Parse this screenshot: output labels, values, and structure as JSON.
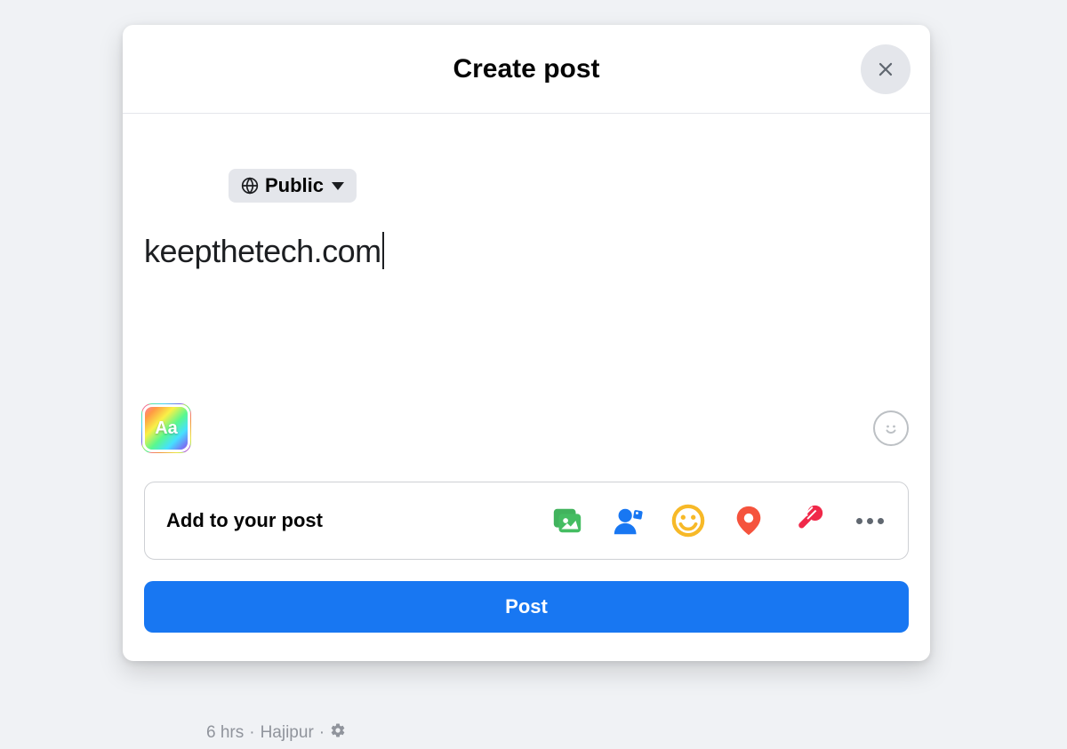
{
  "dialog": {
    "title": "Create post",
    "privacy": {
      "label": "Public",
      "icon": "globe-icon"
    },
    "compose": {
      "text": "keepthetech.com"
    },
    "backgroundPicker": {
      "label": "Aa"
    },
    "addSection": {
      "label": "Add to your post",
      "icons": [
        {
          "name": "photo-video-icon"
        },
        {
          "name": "tag-people-icon"
        },
        {
          "name": "feeling-icon"
        },
        {
          "name": "check-in-icon"
        },
        {
          "name": "live-video-icon"
        },
        {
          "name": "more-icon"
        }
      ]
    },
    "postButton": {
      "label": "Post"
    }
  },
  "behindPost": {
    "timestamp": "6 hrs",
    "separator": "·",
    "location": "Hajipur",
    "separator2": "·"
  }
}
